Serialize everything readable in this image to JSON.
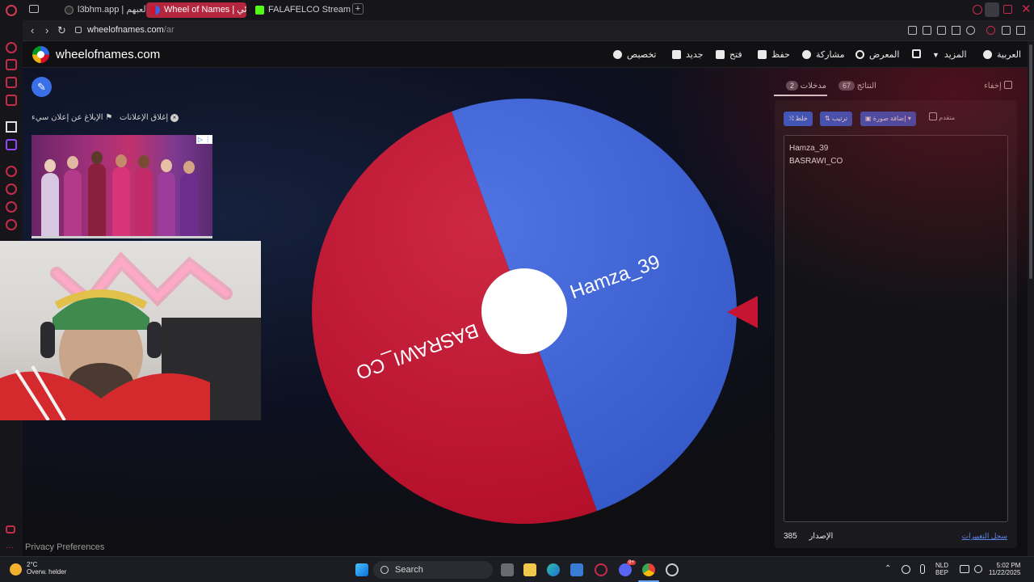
{
  "browser": {
    "tabs": [
      {
        "label": "l3bhm.app | لعبهم"
      },
      {
        "label": "Wheel of Names | عشوائي"
      },
      {
        "label": "FALAFELCO Stream - Wat"
      }
    ],
    "new_tab": "+",
    "url_domain": "wheelofnames.com",
    "url_path": "/ar",
    "back": "‹",
    "forward": "›",
    "reload": "↻"
  },
  "site": {
    "title": "wheelofnames.com",
    "menu": {
      "language": "العربية",
      "more": "المزيد",
      "gallery": "المعرض",
      "share": "مشاركة",
      "save": "حفظ",
      "open": "فتح",
      "new": "جديد",
      "customize": "تخصيص"
    }
  },
  "ads": {
    "close_ads": "إغلاق الإعلانات",
    "report_ad": "الإبلاغ عن إعلان سيء",
    "ad_choice": "▷ ⋮"
  },
  "wheel": {
    "segments": [
      {
        "label": "Hamza_39",
        "color": "#3b63df"
      },
      {
        "label": "BASRAWI_CO",
        "color": "#c8102e"
      }
    ],
    "pointer_color": "#c61532"
  },
  "panel": {
    "hide_label": "إخفاء",
    "results_tab": "النتائج",
    "results_count": "67",
    "entries_tab": "مدخلات",
    "entries_count": "2",
    "advanced_label": "متقدم",
    "add_image_btn": "إضافة صورة",
    "sort_btn": "ترتيب",
    "shuffle_btn": "خلط",
    "entries": [
      "Hamza_39",
      "BASRAWI_CO"
    ],
    "version_label": "الإصدار",
    "version_number": "385",
    "changelog": "سجل التغييرات"
  },
  "footer": {
    "privacy": "Privacy Preferences"
  },
  "taskbar": {
    "weather_temp": "2°C",
    "weather_desc": "Overw. helder",
    "search": "Search",
    "lang_top": "NLD",
    "lang_bottom": "BEP",
    "time": "5:02 PM",
    "date": "11/22/2025",
    "discord_badge": "9+"
  },
  "colors": {
    "accent": "#2e66d9",
    "opera_red": "#c72b4a",
    "active_tab": "#b3263e"
  }
}
